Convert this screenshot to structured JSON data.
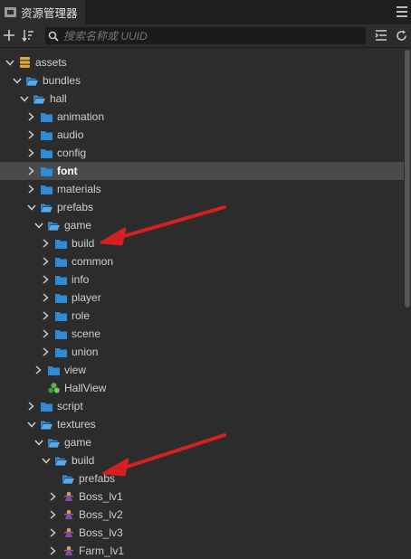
{
  "panel": {
    "title": "资源管理器"
  },
  "toolbar": {
    "search_placeholder": "搜索名称或 UUID"
  },
  "colors": {
    "folder": "#2f8bd8",
    "folder_open": "#3d9be9",
    "selection": "#4a4a4a",
    "annotation_arrow": "#d42020"
  },
  "tree": [
    {
      "label": "assets",
      "depth": 0,
      "expanded": true,
      "icon": "database-icon"
    },
    {
      "label": "bundles",
      "depth": 1,
      "expanded": true,
      "icon": "folder-open-icon"
    },
    {
      "label": "hall",
      "depth": 2,
      "expanded": true,
      "icon": "folder-open-icon"
    },
    {
      "label": "animation",
      "depth": 3,
      "expanded": false,
      "icon": "folder-icon"
    },
    {
      "label": "audio",
      "depth": 3,
      "expanded": false,
      "icon": "folder-icon"
    },
    {
      "label": "config",
      "depth": 3,
      "expanded": false,
      "icon": "folder-icon"
    },
    {
      "label": "font",
      "depth": 3,
      "expanded": false,
      "icon": "folder-icon",
      "selected": true
    },
    {
      "label": "materials",
      "depth": 3,
      "expanded": false,
      "icon": "folder-icon"
    },
    {
      "label": "prefabs",
      "depth": 3,
      "expanded": true,
      "icon": "folder-open-icon"
    },
    {
      "label": "game",
      "depth": 4,
      "expanded": true,
      "icon": "folder-open-icon"
    },
    {
      "label": "build",
      "depth": 5,
      "expanded": false,
      "icon": "folder-icon"
    },
    {
      "label": "common",
      "depth": 5,
      "expanded": false,
      "icon": "folder-icon"
    },
    {
      "label": "info",
      "depth": 5,
      "expanded": false,
      "icon": "folder-icon"
    },
    {
      "label": "player",
      "depth": 5,
      "expanded": false,
      "icon": "folder-icon"
    },
    {
      "label": "role",
      "depth": 5,
      "expanded": false,
      "icon": "folder-icon"
    },
    {
      "label": "scene",
      "depth": 5,
      "expanded": false,
      "icon": "folder-icon"
    },
    {
      "label": "union",
      "depth": 5,
      "expanded": false,
      "icon": "folder-icon"
    },
    {
      "label": "view",
      "depth": 4,
      "expanded": false,
      "icon": "folder-icon"
    },
    {
      "label": "HallView",
      "depth": 4,
      "leaf": true,
      "icon": "prefab-icon"
    },
    {
      "label": "script",
      "depth": 3,
      "expanded": false,
      "icon": "folder-icon"
    },
    {
      "label": "textures",
      "depth": 3,
      "expanded": true,
      "icon": "folder-open-icon"
    },
    {
      "label": "game",
      "depth": 4,
      "expanded": true,
      "icon": "folder-open-icon"
    },
    {
      "label": "build",
      "depth": 5,
      "expanded": true,
      "icon": "folder-open-icon"
    },
    {
      "label": "prefabs",
      "depth": 6,
      "leaf": true,
      "icon": "folder-open-icon"
    },
    {
      "label": "Boss_lv1",
      "depth": 6,
      "expanded": false,
      "icon": "sprite-icon"
    },
    {
      "label": "Boss_lv2",
      "depth": 6,
      "expanded": false,
      "icon": "sprite-icon"
    },
    {
      "label": "Boss_lv3",
      "depth": 6,
      "expanded": false,
      "icon": "sprite-icon"
    },
    {
      "label": "Farm_lv1",
      "depth": 6,
      "expanded": false,
      "icon": "sprite-icon"
    }
  ]
}
